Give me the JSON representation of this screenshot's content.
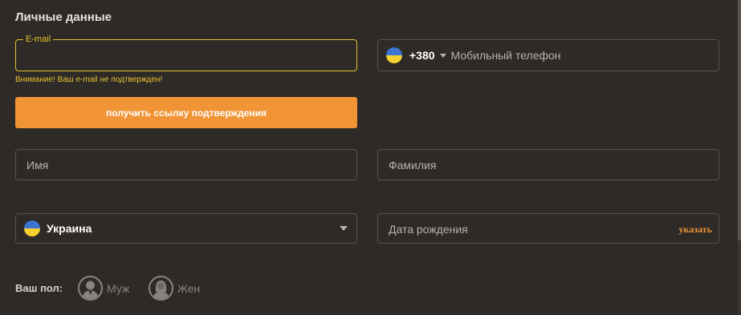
{
  "section": {
    "title": "Личные данные"
  },
  "email": {
    "legend": "E-mail",
    "value": "",
    "warning": "Внимание! Ваш e-mail не подтвержден!"
  },
  "confirm_button": {
    "label": "получить ссылку подтверждения"
  },
  "phone": {
    "flag_icon": "ukraine-flag-icon",
    "code": "+380",
    "placeholder": "Мобильный телефон"
  },
  "first_name": {
    "placeholder": "Имя"
  },
  "last_name": {
    "placeholder": "Фамилия"
  },
  "country": {
    "flag_icon": "ukraine-flag-icon",
    "value": "Украина"
  },
  "birth_date": {
    "placeholder": "Дата рождения",
    "action_label": "указать"
  },
  "gender": {
    "label": "Ваш пол:",
    "options": [
      {
        "label": "Муж",
        "icon": "male-avatar-icon"
      },
      {
        "label": "Жен",
        "icon": "female-avatar-icon"
      }
    ]
  },
  "colors": {
    "accent": "#f19436",
    "warning": "#e8c12f",
    "background": "#2e2a27",
    "border": "#5a534d"
  }
}
